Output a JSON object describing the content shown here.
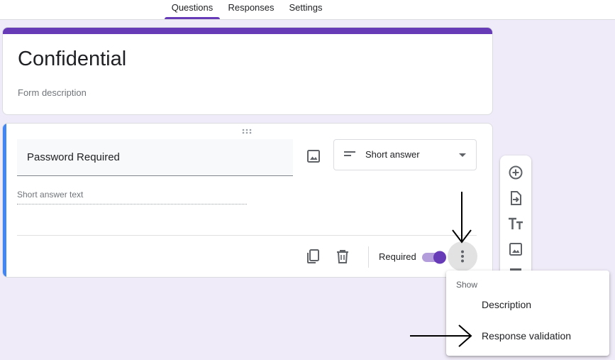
{
  "tabs": {
    "questions": "Questions",
    "responses": "Responses",
    "settings": "Settings",
    "active": "questions"
  },
  "form": {
    "title": "Confidential",
    "description_placeholder": "Form description"
  },
  "question": {
    "title": "Password Required",
    "type": "Short answer",
    "answer_placeholder": "Short answer text",
    "required_label": "Required",
    "required_on": true
  },
  "menu": {
    "header": "Show",
    "items": [
      "Description",
      "Response validation"
    ]
  },
  "icons": {
    "add_question": "add-circle-icon",
    "import": "import-icon",
    "title": "title-text-icon",
    "image": "image-icon"
  },
  "colors": {
    "accent": "#673ab7",
    "focus_bar": "#4285f4",
    "background": "#f0ebf8"
  }
}
